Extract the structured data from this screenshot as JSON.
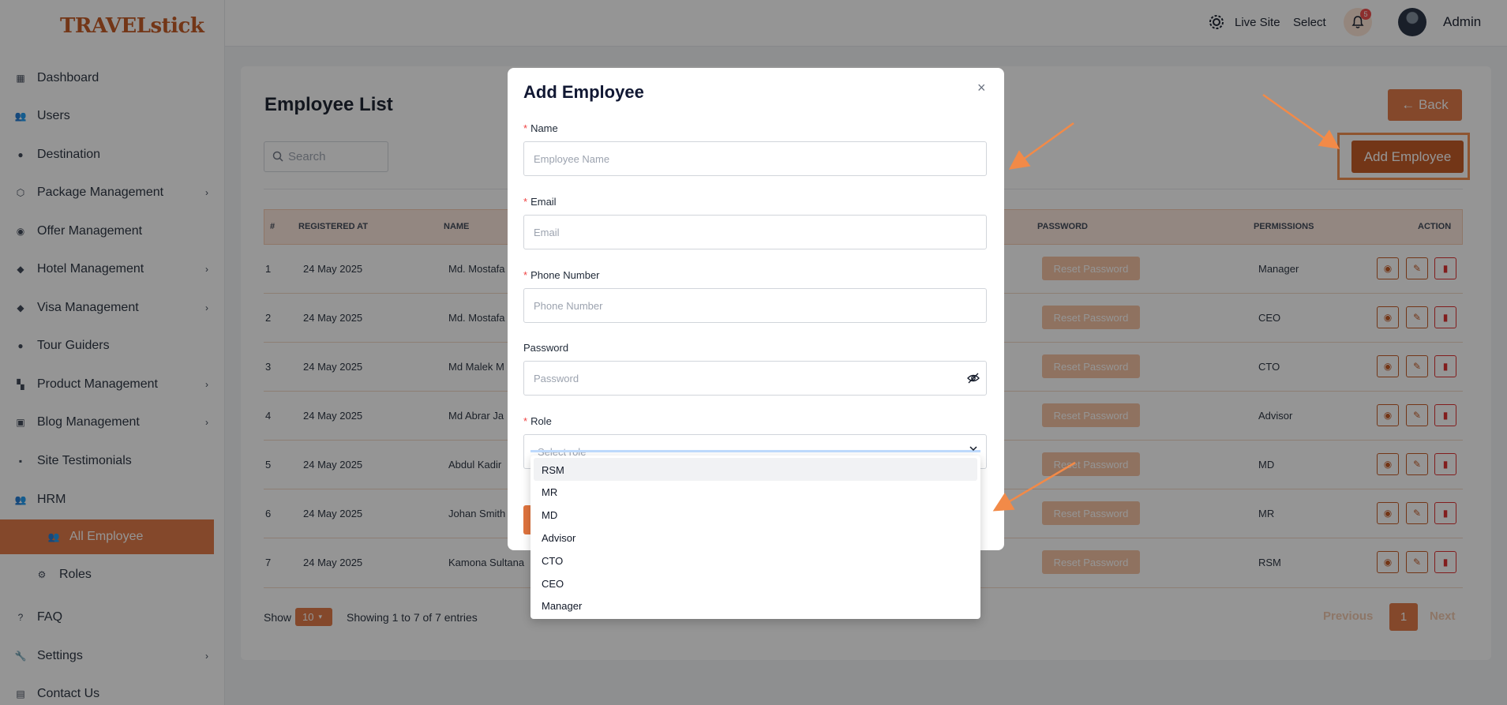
{
  "brand": {
    "logo_main": "TRAVELstick"
  },
  "topbar": {
    "live_site": "Live Site",
    "select": "Select",
    "notification_count": "5",
    "user": "Admin"
  },
  "sidebar": {
    "items": [
      {
        "label": "Dashboard",
        "icon": "dashboard-icon",
        "submenu": false
      },
      {
        "label": "Users",
        "icon": "users-icon",
        "submenu": false
      },
      {
        "label": "Destination",
        "icon": "pin-icon",
        "submenu": false
      },
      {
        "label": "Package Management",
        "icon": "box-icon",
        "submenu": true
      },
      {
        "label": "Offer Management",
        "icon": "offer-icon",
        "submenu": false
      },
      {
        "label": "Hotel Management",
        "icon": "hotel-icon",
        "submenu": true
      },
      {
        "label": "Visa Management",
        "icon": "visa-icon",
        "submenu": true
      },
      {
        "label": "Tour Guiders",
        "icon": "person-icon",
        "submenu": false
      },
      {
        "label": "Product Management",
        "icon": "grid-icon",
        "submenu": true
      },
      {
        "label": "Blog Management",
        "icon": "blog-icon",
        "submenu": true
      },
      {
        "label": "Site Testimonials",
        "icon": "comment-icon",
        "submenu": false
      },
      {
        "label": "HRM",
        "icon": "team-icon",
        "submenu": false
      },
      {
        "label": "All Employee",
        "icon": "team-icon",
        "submenu": false,
        "active": true
      },
      {
        "label": "Roles",
        "icon": "roles-icon",
        "submenu": false
      },
      {
        "label": "FAQ",
        "icon": "question-icon",
        "submenu": false
      },
      {
        "label": "Settings",
        "icon": "wrench-icon",
        "submenu": true
      },
      {
        "label": "Contact Us",
        "icon": "contact-icon",
        "submenu": false
      }
    ]
  },
  "page": {
    "title": "Employee List",
    "search_placeholder": "Search",
    "back_label": "← Back",
    "add_label": "Add Employee"
  },
  "table": {
    "headers": [
      "#",
      "REGISTERED AT",
      "NAME",
      "PASSWORD",
      "PERMISSIONS",
      "ACTION"
    ],
    "reset_label": "Reset Password",
    "rows": [
      {
        "num": "1",
        "date": "24 May 2025",
        "name": "Md. Mostafa",
        "permission": "Manager"
      },
      {
        "num": "2",
        "date": "24 May 2025",
        "name": "Md. Mostafa",
        "permission": "CEO"
      },
      {
        "num": "3",
        "date": "24 May 2025",
        "name": "Md Malek M",
        "permission": "CTO"
      },
      {
        "num": "4",
        "date": "24 May 2025",
        "name": "Md Abrar Ja",
        "permission": "Advisor"
      },
      {
        "num": "5",
        "date": "24 May 2025",
        "name": "Abdul Kadir",
        "permission": "MD"
      },
      {
        "num": "6",
        "date": "24 May 2025",
        "name": "Johan Smith",
        "permission": "MR"
      },
      {
        "num": "7",
        "date": "24 May 2025",
        "name": "Kamona Sultana",
        "permission": "RSM"
      }
    ]
  },
  "footer": {
    "show": "Show",
    "page_size": "10",
    "info": "Showing 1 to 7 of 7 entries",
    "previous": "Previous",
    "current_page": "1",
    "next": "Next"
  },
  "modal": {
    "title": "Add Employee",
    "close": "×",
    "name_label": "Name",
    "name_placeholder": "Employee Name",
    "email_label": "Email",
    "email_placeholder": "Email",
    "phone_label": "Phone Number",
    "phone_placeholder": "Phone Number",
    "password_label": "Password",
    "password_placeholder": "Password",
    "role_label": "Role",
    "role_placeholder": "Select role",
    "role_options": [
      "RSM",
      "MR",
      "MD",
      "Advisor",
      "CTO",
      "CEO",
      "Manager"
    ]
  },
  "colors": {
    "accent": "#e0743e",
    "accent_dark": "#c2531b",
    "annotation": "#f28a48"
  }
}
